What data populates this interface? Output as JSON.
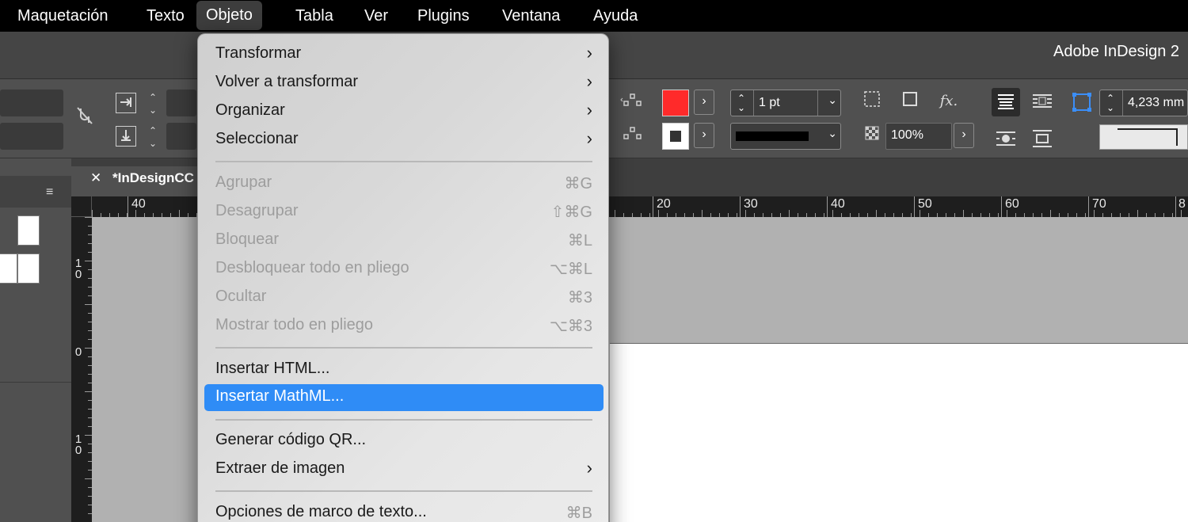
{
  "menubar": {
    "items": [
      "Maquetación",
      "Texto",
      "Objeto",
      "Tabla",
      "Ver",
      "Plugins",
      "Ventana",
      "Ayuda"
    ],
    "active_index": 2
  },
  "titlebar": {
    "title": "Adobe InDesign 2"
  },
  "control": {
    "stroke_weight": "1 pt",
    "opacity": "100%",
    "dimension": "4,233 mm",
    "fill_color": "#ff2a2a"
  },
  "document": {
    "tab_title": "*InDesignCC"
  },
  "rulers": {
    "h_labels": [
      "40",
      "20",
      "30",
      "40",
      "50",
      "60",
      "70",
      "8"
    ],
    "v_labels": [
      "1\n0",
      "0",
      "1\n0"
    ]
  },
  "dropdown": {
    "items": [
      {
        "label": "Transformar",
        "shortcut": "",
        "submenu": true,
        "disabled": false
      },
      {
        "label": "Volver a transformar",
        "shortcut": "",
        "submenu": true,
        "disabled": false
      },
      {
        "label": "Organizar",
        "shortcut": "",
        "submenu": true,
        "disabled": false
      },
      {
        "label": "Seleccionar",
        "shortcut": "",
        "submenu": true,
        "disabled": false
      },
      {
        "label": "Agrupar",
        "shortcut": "⌘G",
        "submenu": false,
        "disabled": true
      },
      {
        "label": "Desagrupar",
        "shortcut": "⇧⌘G",
        "submenu": false,
        "disabled": true
      },
      {
        "label": "Bloquear",
        "shortcut": "⌘L",
        "submenu": false,
        "disabled": true
      },
      {
        "label": "Desbloquear todo en pliego",
        "shortcut": "⌥⌘L",
        "submenu": false,
        "disabled": true
      },
      {
        "label": "Ocultar",
        "shortcut": "⌘3",
        "submenu": false,
        "disabled": true
      },
      {
        "label": "Mostrar todo en pliego",
        "shortcut": "⌥⌘3",
        "submenu": false,
        "disabled": true
      },
      {
        "label": "Insertar HTML...",
        "shortcut": "",
        "submenu": false,
        "disabled": false
      },
      {
        "label": "Insertar MathML...",
        "shortcut": "",
        "submenu": false,
        "disabled": false,
        "selected": true
      },
      {
        "label": "Generar código QR...",
        "shortcut": "",
        "submenu": false,
        "disabled": false
      },
      {
        "label": "Extraer de imagen",
        "shortcut": "",
        "submenu": true,
        "disabled": false
      },
      {
        "label": "Opciones de marco de texto...",
        "shortcut": "⌘B",
        "submenu": false,
        "disabled": false
      }
    ],
    "selection_color": "#2f8cf6"
  }
}
